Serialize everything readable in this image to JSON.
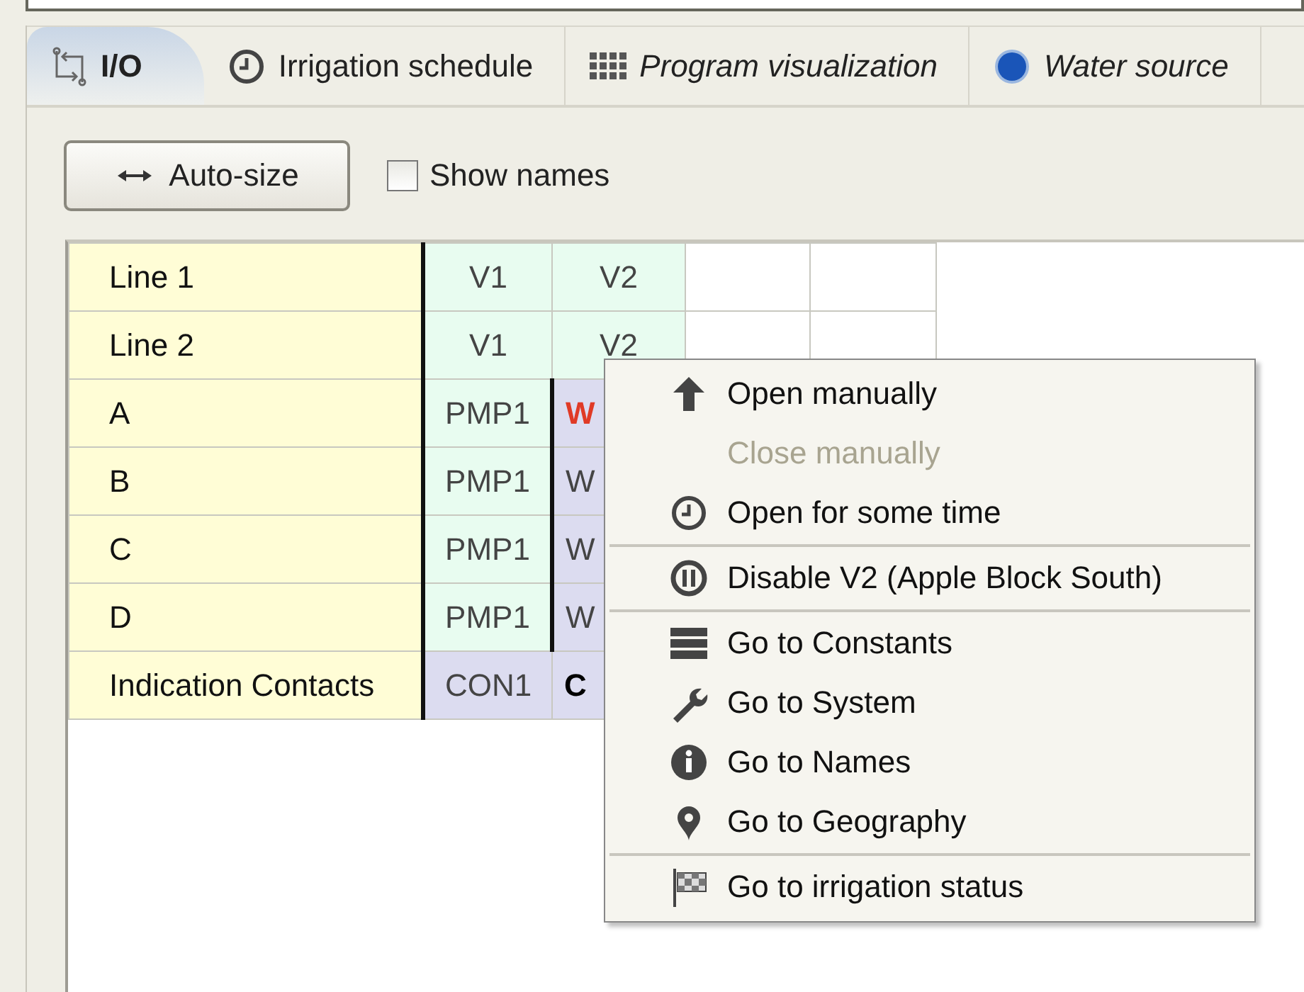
{
  "tabs": [
    {
      "label": "I/O",
      "kind": "io",
      "selected": true,
      "italic": false
    },
    {
      "label": "Irrigation schedule",
      "kind": "schedule",
      "selected": false,
      "italic": false
    },
    {
      "label": "Program visualization",
      "kind": "visualization",
      "selected": false,
      "italic": true
    },
    {
      "label": "Water source",
      "kind": "source",
      "selected": false,
      "italic": true
    }
  ],
  "toolbar": {
    "autosize_button": "Auto-size",
    "show_names": {
      "label": "Show names",
      "checked": false
    }
  },
  "grid": {
    "rows": [
      {
        "label": "Line 1",
        "cells": [
          {
            "text": "V1",
            "kind": "output",
            "alert": false,
            "emphasized": false,
            "divider": true
          },
          {
            "text": "V2",
            "kind": "output",
            "alert": false,
            "emphasized": false,
            "divider": false
          },
          {
            "kind": "empty"
          },
          {
            "kind": "empty"
          }
        ]
      },
      {
        "label": "Line 2",
        "cells": [
          {
            "text": "V1",
            "kind": "output",
            "alert": false,
            "emphasized": false,
            "divider": true
          },
          {
            "text": "V2",
            "kind": "output",
            "alert": false,
            "emphasized": false,
            "divider": false
          },
          {
            "kind": "empty"
          },
          {
            "kind": "empty"
          }
        ]
      },
      {
        "label": "A",
        "cells": [
          {
            "text": "PMP1",
            "kind": "output",
            "alert": false,
            "emphasized": false,
            "divider": true
          },
          {
            "text": "W",
            "kind": "input",
            "alert": true,
            "emphasized": false,
            "divider": true
          }
        ]
      },
      {
        "label": "B",
        "cells": [
          {
            "text": "PMP1",
            "kind": "output",
            "alert": false,
            "emphasized": false,
            "divider": true
          },
          {
            "text": "W",
            "kind": "input",
            "alert": false,
            "emphasized": false,
            "divider": true
          }
        ]
      },
      {
        "label": "C",
        "cells": [
          {
            "text": "PMP1",
            "kind": "output",
            "alert": false,
            "emphasized": false,
            "divider": true
          },
          {
            "text": "W",
            "kind": "input",
            "alert": false,
            "emphasized": false,
            "divider": true
          }
        ]
      },
      {
        "label": "D",
        "cells": [
          {
            "text": "PMP1",
            "kind": "output",
            "alert": false,
            "emphasized": false,
            "divider": true
          },
          {
            "text": "W",
            "kind": "input",
            "alert": false,
            "emphasized": false,
            "divider": true
          }
        ]
      },
      {
        "label": "Indication Contacts",
        "cells": [
          {
            "text": "CON1",
            "kind": "input",
            "alert": false,
            "emphasized": false,
            "divider": true
          },
          {
            "text": "C",
            "kind": "input",
            "alert": false,
            "emphasized": true,
            "divider": false
          }
        ]
      }
    ]
  },
  "context_menu": {
    "groups": [
      [
        {
          "label": "Open manually",
          "kind": "open",
          "disabled": false
        },
        {
          "label": "Close manually",
          "kind": "close",
          "disabled": true
        },
        {
          "label": "Open for some time",
          "kind": "timed",
          "disabled": false
        }
      ],
      [
        {
          "label": "Disable V2 (Apple Block South)",
          "kind": "disable",
          "disabled": false
        }
      ],
      [
        {
          "label": "Go to Constants",
          "kind": "constants",
          "disabled": false
        },
        {
          "label": "Go to System",
          "kind": "system",
          "disabled": false
        },
        {
          "label": "Go to Names",
          "kind": "names",
          "disabled": false
        },
        {
          "label": "Go to Geography",
          "kind": "geography",
          "disabled": false
        }
      ],
      [
        {
          "label": "Go to irrigation status",
          "kind": "status",
          "disabled": false
        }
      ]
    ]
  }
}
